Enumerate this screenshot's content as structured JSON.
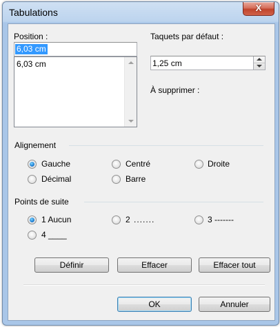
{
  "window": {
    "title": "Tabulations",
    "close_glyph": "X"
  },
  "position": {
    "label": "Position :",
    "value": "6,03 cm",
    "list_items": [
      "6,03 cm"
    ]
  },
  "default_tabs": {
    "label": "Taquets par défaut :",
    "value": "1,25 cm"
  },
  "to_delete": {
    "label": "À supprimer :"
  },
  "alignment": {
    "label": "Alignement",
    "options": [
      {
        "label": "Gauche",
        "selected": true
      },
      {
        "label": "Centré",
        "selected": false
      },
      {
        "label": "Droite",
        "selected": false
      },
      {
        "label": "Décimal",
        "selected": false
      },
      {
        "label": "Barre",
        "selected": false
      }
    ]
  },
  "leader": {
    "label": "Points de suite",
    "options": [
      {
        "label": "1 Aucun",
        "selected": true
      },
      {
        "label": "2 .......",
        "selected": false
      },
      {
        "label": "3 -------",
        "selected": false
      },
      {
        "label": "4 ____",
        "selected": false
      }
    ]
  },
  "actions": {
    "set": "Définir",
    "clear": "Effacer",
    "clear_all": "Effacer tout"
  },
  "footer": {
    "ok": "OK",
    "cancel": "Annuler"
  },
  "colors": {
    "selection": "#3399ff",
    "title_bar": "#bcd4ee",
    "close_button": "#c0442c",
    "dialog_bg": "#f0f0f0"
  }
}
